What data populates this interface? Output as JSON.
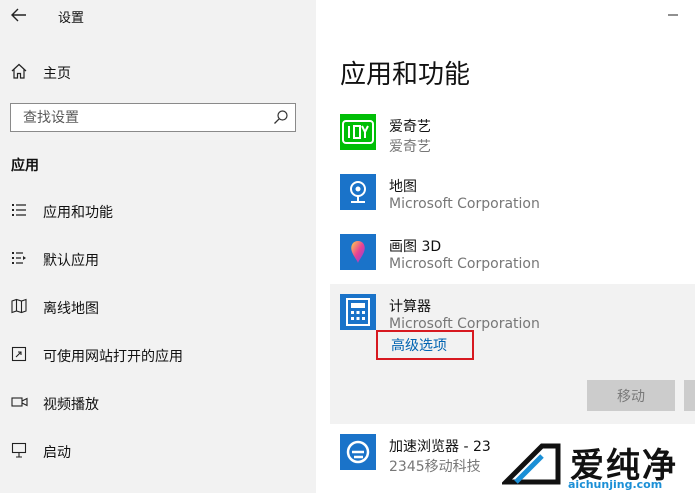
{
  "window": {
    "title": "设置"
  },
  "sidebar": {
    "home": "主页",
    "search": {
      "placeholder": "查找设置"
    },
    "section": "应用",
    "items": [
      {
        "label": "应用和功能",
        "icon": "apps-list-icon"
      },
      {
        "label": "默认应用",
        "icon": "default-apps-icon"
      },
      {
        "label": "离线地图",
        "icon": "offline-maps-icon"
      },
      {
        "label": "可使用网站打开的应用",
        "icon": "apps-for-websites-icon"
      },
      {
        "label": "视频播放",
        "icon": "video-playback-icon"
      },
      {
        "label": "启动",
        "icon": "startup-icon"
      }
    ]
  },
  "main": {
    "title": "应用和功能",
    "apps": [
      {
        "name": "爱奇艺",
        "publisher": "爱奇艺",
        "icon": "iqiyi-icon",
        "color": "#00be06"
      },
      {
        "name": "地图",
        "publisher": "Microsoft Corporation",
        "icon": "maps-icon",
        "color": "#1a73c9"
      },
      {
        "name": "画图 3D",
        "publisher": "Microsoft Corporation",
        "icon": "paint3d-icon",
        "color": "#1a73c9"
      },
      {
        "name": "计算器",
        "publisher": "Microsoft Corporation",
        "icon": "calculator-icon",
        "color": "#1a73c9"
      },
      {
        "name": "加速浏览器 - 23",
        "publisher": "2345移动科技",
        "icon": "browser-icon",
        "color": "#1a73c9"
      }
    ],
    "selected": {
      "advanced_link": "高级选项",
      "move_label": "移动"
    }
  },
  "watermark": {
    "name": "爱纯净",
    "url": "aichunjing.com"
  },
  "colors": {
    "sidebar_bg": "#f2f2f2",
    "accent": "#0063b1",
    "highlight": "#d71920"
  }
}
